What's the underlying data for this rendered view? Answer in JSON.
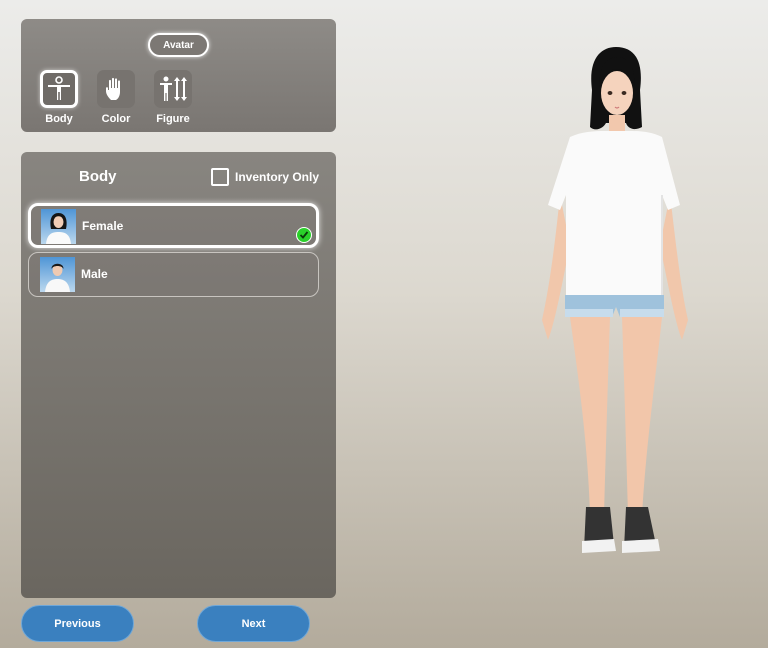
{
  "header": {
    "avatar_label": "Avatar"
  },
  "tabs": [
    {
      "label": "Body",
      "icon": "body-icon",
      "active": true
    },
    {
      "label": "Color",
      "icon": "hand-icon",
      "active": false
    },
    {
      "label": "Figure",
      "icon": "figure-adjust-icon",
      "active": false
    }
  ],
  "panel": {
    "title": "Body",
    "inventory_only_label": "Inventory Only",
    "inventory_only_checked": false,
    "items": [
      {
        "label": "Female",
        "selected": true
      },
      {
        "label": "Male",
        "selected": false
      }
    ]
  },
  "nav": {
    "previous_label": "Previous",
    "next_label": "Next"
  },
  "colors": {
    "button_blue": "#3a80bf",
    "check_green": "#2ad02a",
    "panel_gray": "#7c7874"
  }
}
